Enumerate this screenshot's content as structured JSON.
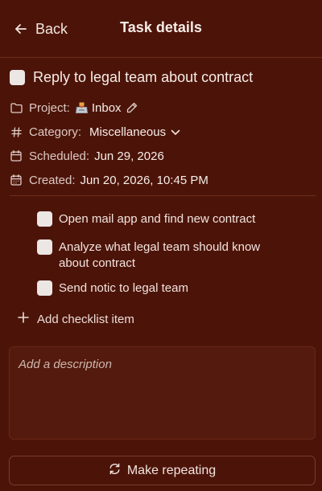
{
  "header": {
    "back_label": "Back",
    "title": "Task details"
  },
  "task": {
    "title": "Reply to legal team about contract",
    "completed": false
  },
  "meta": {
    "project_label": "Project:",
    "project_value": "Inbox",
    "category_label": "Category:",
    "category_value": "Miscellaneous",
    "scheduled_label": "Scheduled:",
    "scheduled_value": "Jun 29, 2026",
    "created_label": "Created:",
    "created_value": "Jun 20, 2026, 10:45 PM"
  },
  "checklist": {
    "items": [
      {
        "text": "Open mail app and find new contract",
        "checked": false
      },
      {
        "text": "Analyze what legal team should know about contract",
        "checked": false
      },
      {
        "text": "Send notic to legal team",
        "checked": false
      }
    ],
    "add_label": "Add checklist item"
  },
  "description": {
    "placeholder": "Add a description"
  },
  "repeat_button": {
    "label": "Make repeating"
  },
  "icons": {
    "back": "arrow-left-icon",
    "project": "folder-icon",
    "inbox": "inbox-tray-icon",
    "edit": "pencil-icon",
    "category": "hash-icon",
    "category_toggle": "chevron-down-icon",
    "scheduled": "calendar-icon",
    "created": "calendar-grid-icon",
    "add": "plus-icon",
    "repeat": "repeat-icon"
  },
  "colors": {
    "background": "#4c1409",
    "text": "#f3e4de",
    "divider": "#6e2a1b",
    "checkbox": "#ece6e4"
  }
}
